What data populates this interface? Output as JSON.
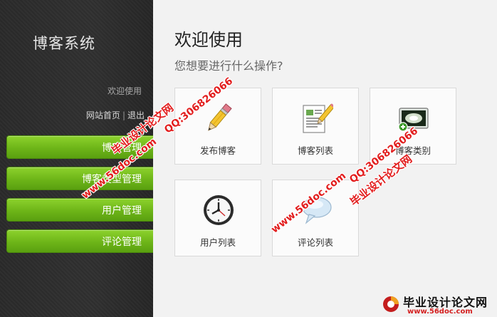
{
  "sidebar": {
    "app_title": "博客系统",
    "welcome": "欢迎使用",
    "links": {
      "home": "网站首页",
      "separator": "|",
      "logout": "退出"
    },
    "nav": [
      {
        "label": "博客管理"
      },
      {
        "label": "博客类型管理"
      },
      {
        "label": "用户管理"
      },
      {
        "label": "评论管理"
      }
    ]
  },
  "main": {
    "title": "欢迎使用",
    "subtitle": "您想要进行什么操作?",
    "tiles": [
      {
        "label": "发布博客",
        "icon": "pencil-icon"
      },
      {
        "label": "博客列表",
        "icon": "document-pencil-icon"
      },
      {
        "label": "博客类别",
        "icon": "image-add-icon"
      },
      {
        "label": "用户列表",
        "icon": "clock-icon"
      },
      {
        "label": "评论列表",
        "icon": "speech-bubble-icon"
      }
    ]
  },
  "watermarks": {
    "site_name": "毕业设计论文网",
    "qq": "QQ:306826066",
    "url": "www.56doc.com",
    "footer_name": "毕业设计论文网",
    "footer_url": "www.56doc.com"
  },
  "colors": {
    "sidebar_bg": "#2d2d2d",
    "nav_green": "#6db518",
    "watermark_red": "#e21d1d"
  }
}
